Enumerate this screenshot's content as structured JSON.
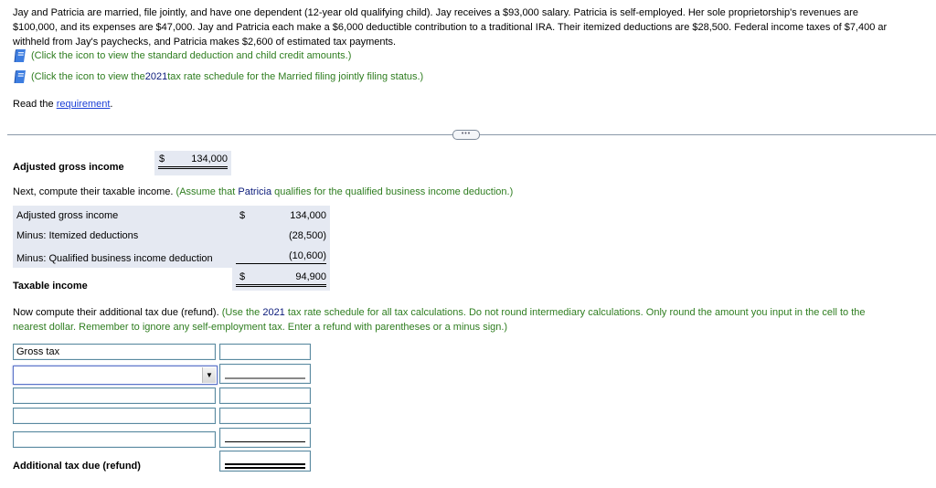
{
  "problem": {
    "lines": [
      "Jay and Patricia are married, file jointly, and have one dependent (12-year old qualifying child). Jay receives a $93,000 salary. Patricia is self-employed. Her sole proprietorship's revenues are",
      "$100,000, and its expenses are $47,000. Jay and Patricia each make a $6,000 deductible contribution to a traditional IRA. Their itemized deductions are $28,500. Federal income taxes of $7,400 ar",
      "withheld from Jay's paychecks, and Patricia makes $2,600 of estimated tax payments."
    ],
    "icon_links": [
      {
        "icon": "book-icon",
        "text": "(Click the icon to view the standard deduction and child credit amounts.)"
      },
      {
        "icon": "book-icon",
        "text_before": "(Click the icon to view the ",
        "year": "2021",
        "text_after": " tax rate schedule for the Married filing jointly filing status.)"
      }
    ],
    "read_prefix": "Read the ",
    "read_link": "requirement",
    "read_suffix": "."
  },
  "divider": {
    "more_label": "•••"
  },
  "agi_summary": {
    "label": "Adjusted gross income",
    "currency": "$",
    "value": "134,000"
  },
  "taxable_instruction": {
    "prefix": "Next, compute their taxable income. ",
    "hint_before": "(Assume that ",
    "hint_name": "Patricia",
    "hint_after": " qualifies for the qualified business income deduction.)"
  },
  "taxable_table": {
    "rows": [
      {
        "label": "Adjusted gross income",
        "currency": "$",
        "value": "134,000"
      },
      {
        "label": "Minus: Itemized deductions",
        "currency": "",
        "value": "(28,500)"
      },
      {
        "label": "Minus: Qualified business income deduction",
        "currency": "",
        "value": "(10,600)"
      }
    ],
    "total": {
      "label": "Taxable income",
      "currency": "$",
      "value": "94,900"
    }
  },
  "tax_instruction": {
    "prefix": "Now compute their additional tax due (refund). ",
    "hint_before": "(Use the ",
    "year": "2021",
    "hint_line1_after": " tax rate schedule for all tax calculations. Do not round intermediary calculations. Only round the amount you input in the cell to the",
    "hint_line2": "nearest dollar. Remember to ignore any self-employment tax. Enter a refund with parentheses or a minus sign.)"
  },
  "tax_form": {
    "rows": [
      {
        "label_value": "Gross tax",
        "amount": ""
      },
      {
        "select_value": "",
        "amount": ""
      },
      {
        "label_value": "",
        "amount": ""
      },
      {
        "label_value": "",
        "amount": ""
      },
      {
        "label_value": "",
        "amount": ""
      }
    ],
    "total_label": "Additional tax due (refund)",
    "total_amount": ""
  }
}
